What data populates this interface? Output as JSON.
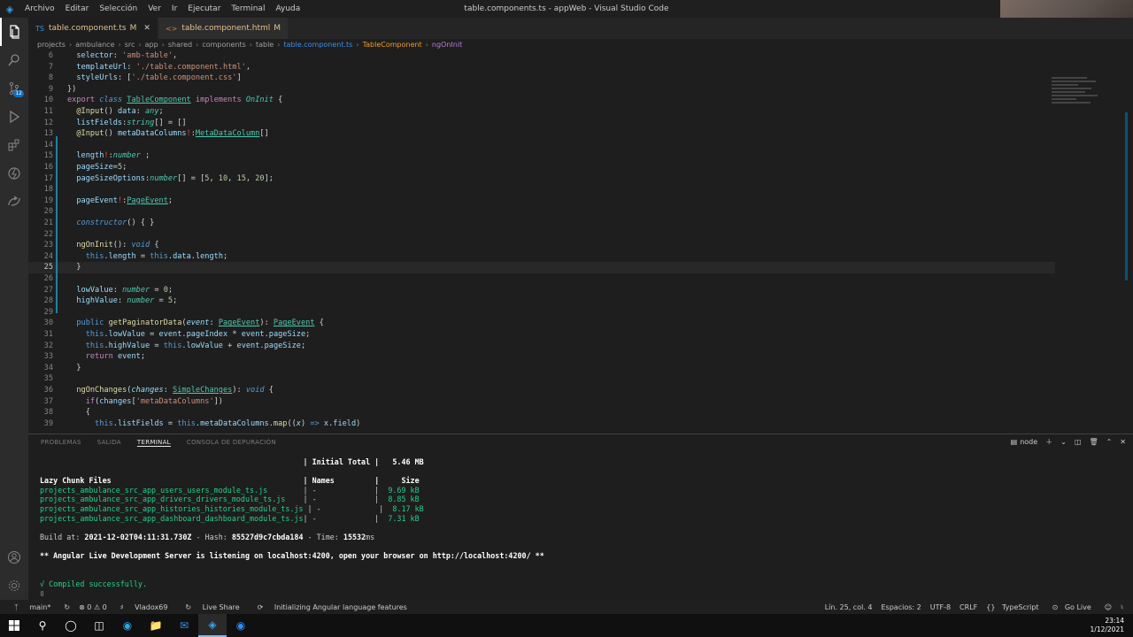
{
  "titlebar": {
    "menu": [
      "Archivo",
      "Editar",
      "Selección",
      "Ver",
      "Ir",
      "Ejecutar",
      "Terminal",
      "Ayuda"
    ],
    "title": "table.components.ts - appWeb - Visual Studio Code"
  },
  "activity": {
    "items": [
      "explorer-icon",
      "search-icon",
      "source-control-icon",
      "run-debug-icon",
      "extensions-icon",
      "remote-icon",
      "live-share-icon"
    ],
    "scm_badge": "12",
    "bottom": [
      "account-icon",
      "settings-gear-icon"
    ]
  },
  "tabs": [
    {
      "label": "table.component.ts",
      "modified": "M",
      "icon": "TS",
      "active": true
    },
    {
      "label": "table.component.html",
      "modified": "M",
      "icon": "<>",
      "active": false
    }
  ],
  "breadcrumb": [
    "projects",
    "ambulance",
    "src",
    "app",
    "shared",
    "components",
    "table",
    "table.component.ts",
    "TableComponent",
    "ngOnInit"
  ],
  "editor": {
    "lines": [
      {
        "n": "6",
        "html": "  <span class=\"v\">selector</span>: <span class=\"s\">'amb-table'</span>,"
      },
      {
        "n": "7",
        "html": "  <span class=\"v\">templateUrl</span>: <span class=\"s\">'./table.component.html'</span>,"
      },
      {
        "n": "8",
        "html": "  <span class=\"v\">styleUrls</span>: [<span class=\"s\">'./table.component.css'</span>]"
      },
      {
        "n": "9",
        "html": "})"
      },
      {
        "n": "10",
        "html": "<span class=\"k\">export</span> <span class=\"kw it\">class</span> <span class=\"cls\">TableComponent</span> <span class=\"k\">implements</span> <span class=\"t it\">OnInit</span> {"
      },
      {
        "n": "11",
        "html": "  <span class=\"f\">@Input</span>() <span class=\"v\">data</span>: <span class=\"t it\">any</span>;"
      },
      {
        "n": "12",
        "html": "  <span class=\"v\">listFields</span>:<span class=\"t it\">string</span>[] = []"
      },
      {
        "n": "13",
        "html": "  <span class=\"f\">@Input</span>() <span class=\"v\">metaDataColumns</span><span class=\"red\">!</span>:<span class=\"cls\">MetaDataColumn</span>[]"
      },
      {
        "n": "14",
        "html": ""
      },
      {
        "n": "15",
        "html": "  <span class=\"v\">length</span><span class=\"red\">!</span>:<span class=\"t it\">number</span> ;"
      },
      {
        "n": "16",
        "html": "  <span class=\"v\">pageSize</span>=<span class=\"n\">5</span>;"
      },
      {
        "n": "17",
        "html": "  <span class=\"v\">pageSizeOptions</span>:<span class=\"t it\">number</span>[] = [<span class=\"n\">5</span>, <span class=\"n\">10</span>, <span class=\"n\">15</span>, <span class=\"n\">20</span>];"
      },
      {
        "n": "18",
        "html": ""
      },
      {
        "n": "19",
        "html": "  <span class=\"v\">pageEvent</span><span class=\"red\">!</span>:<span class=\"cls\">PageEvent</span>;"
      },
      {
        "n": "20",
        "html": ""
      },
      {
        "n": "21",
        "html": "  <span class=\"kw it\">constructor</span>() { }"
      },
      {
        "n": "22",
        "html": ""
      },
      {
        "n": "23",
        "html": "  <span class=\"f\">ngOnInit</span>(): <span class=\"kw it\">void</span> {"
      },
      {
        "n": "24",
        "html": "    <span class=\"kw\">this</span>.<span class=\"v\">length</span> = <span class=\"kw\">this</span>.<span class=\"v\">data</span>.<span class=\"v\">length</span>;"
      },
      {
        "n": "25",
        "html": "  }",
        "current": true
      },
      {
        "n": "26",
        "html": ""
      },
      {
        "n": "27",
        "html": "  <span class=\"v\">lowValue</span>: <span class=\"t it\">number</span> = <span class=\"n\">0</span>;"
      },
      {
        "n": "28",
        "html": "  <span class=\"v\">highValue</span>: <span class=\"t it\">number</span> = <span class=\"n\">5</span>;"
      },
      {
        "n": "29",
        "html": ""
      },
      {
        "n": "30",
        "html": "  <span class=\"kw\">public</span> <span class=\"f\">getPaginatorData</span>(<span class=\"v it\">event</span>: <span class=\"cls\">PageEvent</span>): <span class=\"cls\">PageEvent</span> {"
      },
      {
        "n": "31",
        "html": "    <span class=\"kw\">this</span>.<span class=\"v\">lowValue</span> = <span class=\"v\">event</span>.<span class=\"v\">pageIndex</span> * <span class=\"v\">event</span>.<span class=\"v\">pageSize</span>;"
      },
      {
        "n": "32",
        "html": "    <span class=\"kw\">this</span>.<span class=\"v\">highValue</span> = <span class=\"kw\">this</span>.<span class=\"v\">lowValue</span> + <span class=\"v\">event</span>.<span class=\"v\">pageSize</span>;"
      },
      {
        "n": "33",
        "html": "    <span class=\"k\">return</span> <span class=\"v\">event</span>;"
      },
      {
        "n": "34",
        "html": "  }"
      },
      {
        "n": "35",
        "html": ""
      },
      {
        "n": "36",
        "html": "  <span class=\"f\">ngOnChanges</span>(<span class=\"v it\">changes</span>: <span class=\"cls\">SimpleChanges</span>): <span class=\"kw it\">void</span> {"
      },
      {
        "n": "37",
        "html": "    <span class=\"k\">if</span>(<span class=\"v\">changes</span>[<span class=\"s\">'metaDataColumns'</span>])"
      },
      {
        "n": "38",
        "html": "    {"
      },
      {
        "n": "39",
        "html": "      <span class=\"kw\">this</span>.<span class=\"v\">listFields</span> = <span class=\"kw\">this</span>.<span class=\"v\">metaDataColumns</span>.<span class=\"f\">map</span>((<span class=\"v it\">x</span>) <span class=\"kw\">=&gt;</span> <span class=\"v\">x</span>.<span class=\"v\">field</span>)"
      }
    ]
  },
  "panel": {
    "tabs": [
      "PROBLEMAS",
      "SALIDA",
      "TERMINAL",
      "CONSOLA DE DEPURACIÓN"
    ],
    "active_tab": "TERMINAL",
    "shell": "node",
    "terminal": {
      "initial_total_label": "| Initial Total |",
      "initial_total_value": "5.46 MB",
      "lazy_header": "Lazy Chunk Files",
      "names_header": "| Names         |",
      "size_header": "Size",
      "chunks": [
        {
          "file": "projects_ambulance_src_app_users_users_module_ts.js",
          "name": "| -             |",
          "size": "9.69 kB"
        },
        {
          "file": "projects_ambulance_src_app_drivers_drivers_module_ts.js",
          "name": "| -             |",
          "size": "8.85 kB"
        },
        {
          "file": "projects_ambulance_src_app_histories_histories_module_ts.js",
          "name": "| -             |",
          "size": "8.17 kB"
        },
        {
          "file": "projects_ambulance_src_app_dashboard_dashboard_module_ts.js",
          "name": "| -             |",
          "size": "7.31 kB"
        }
      ],
      "build_prefix": "Build at: ",
      "build_time": "2021-12-02T04:11:31.730Z",
      "hash_prefix": " - Hash: ",
      "hash": "85527d9c7cbda184",
      "time_prefix": " - Time: ",
      "time": "15532",
      "time_unit": "ms",
      "server_msg": "** Angular Live Development Server is listening on localhost:4200, open your browser on http://localhost:4200/ **",
      "compiled": "√ Compiled successfully."
    }
  },
  "statusbar": {
    "branch": "main*",
    "sync": "↻",
    "errors": "⊗ 0 ⚠ 0",
    "user": "Vladox69",
    "liveshare": "Live Share",
    "angular": "Initializing Angular language features",
    "position": "Lín. 25, col. 4",
    "spaces": "Espacios: 2",
    "encoding": "UTF-8",
    "eol": "CRLF",
    "language": "TypeScript",
    "golive": "Go Live"
  },
  "taskbar": {
    "time": "23:14",
    "date": "1/12/2021"
  },
  "colors": {
    "accent": "#007acc",
    "modified": "#e2c08d",
    "terminal_green": "#23d18b"
  }
}
